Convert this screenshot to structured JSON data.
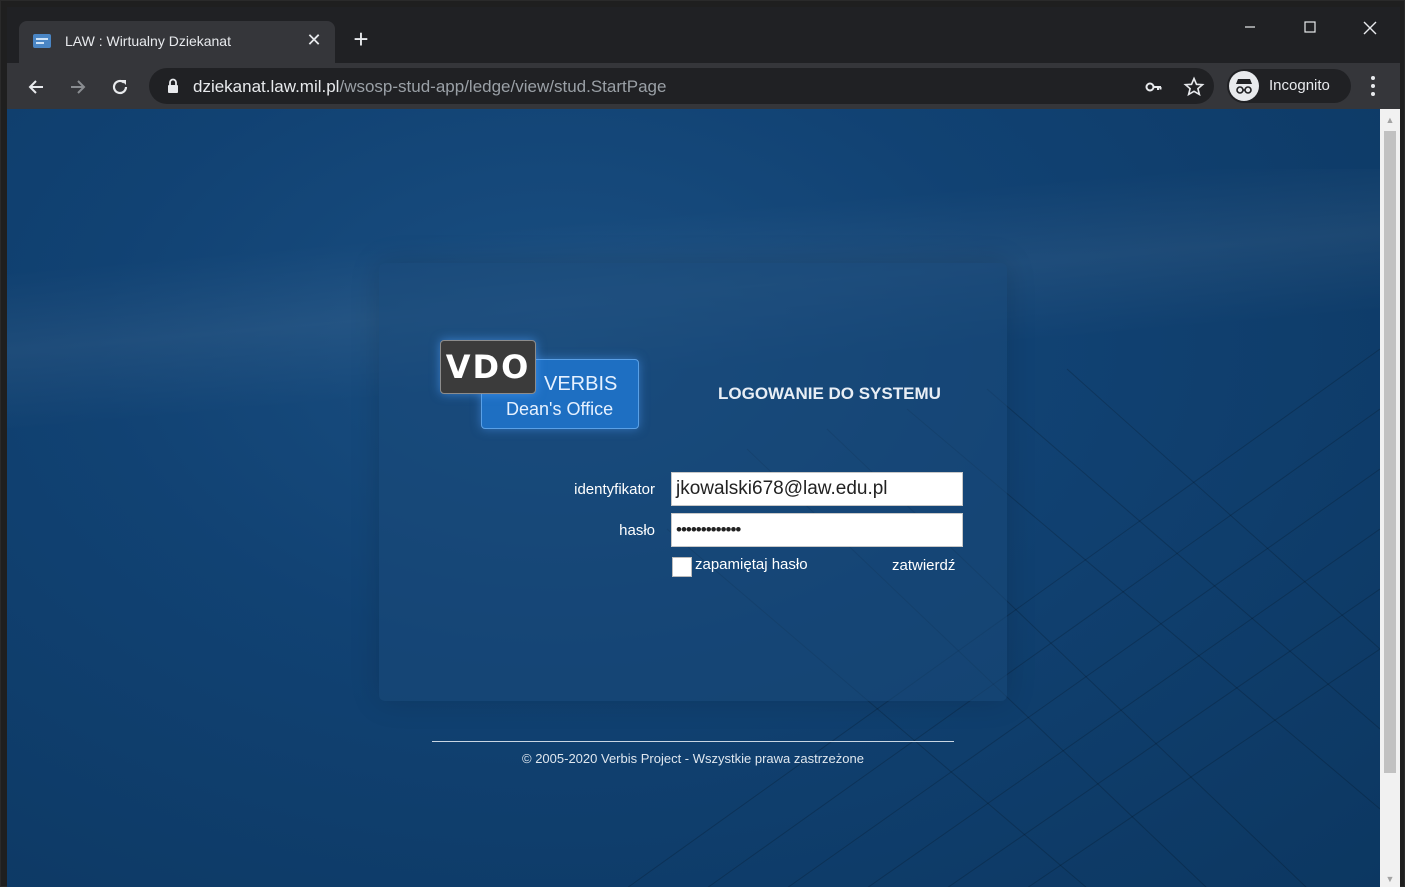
{
  "browser": {
    "tab_title": "LAW : Wirtualny Dziekanat",
    "url_host": "dziekanat.law.mil.pl",
    "url_path": "/wsosp-stud-app/ledge/view/stud.StartPage",
    "profile_label": "Incognito"
  },
  "login": {
    "logo_vdo": "VDO",
    "logo_brand": "VERBIS",
    "logo_sub": "Dean's Office",
    "heading": "LOGOWANIE DO SYSTEMU",
    "id_label": "identyfikator",
    "id_value": "jkowalski678@law.edu.pl",
    "password_label": "hasło",
    "password_value": "•••••••••••••",
    "remember_label": "zapamiętaj hasło",
    "submit_label": "zatwierdź"
  },
  "footer": {
    "copyright": "© 2005-2020 Verbis Project - Wszystkie prawa zastrzeżone"
  },
  "colors": {
    "page_bg": "#114273",
    "chrome_dark": "#202124",
    "chrome_toolbar": "#35363a",
    "logo_blue": "#1e6fc2"
  }
}
